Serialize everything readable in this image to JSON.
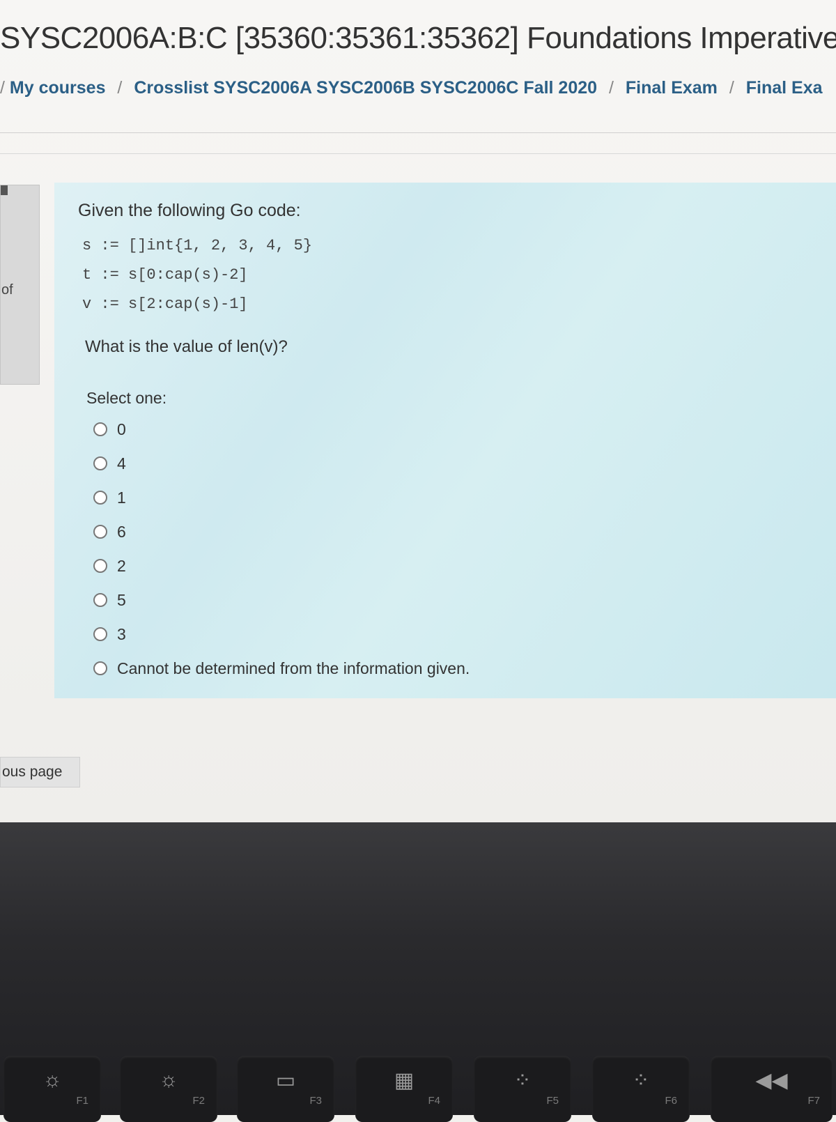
{
  "page": {
    "title": "SYSC2006A:B:C [35360:35361:35362] Foundations Imperative",
    "breadcrumb": [
      "My courses",
      "Crosslist SYSC2006A SYSC2006B SYSC2006C Fall 2020",
      "Final Exam",
      "Final Exa"
    ]
  },
  "sidebar": {
    "info_fragment": "of",
    "previous_page_label": "ous page"
  },
  "question": {
    "intro": "Given the following Go code:",
    "code": [
      "s := []int{1, 2, 3, 4, 5}",
      "t := s[0:cap(s)-2]",
      "v := s[2:cap(s)-1]"
    ],
    "prompt": "What is the value of len(v)?",
    "select_label": "Select one:",
    "options": [
      "0",
      "4",
      "1",
      "6",
      "2",
      "5",
      "3",
      "Cannot be determined from the information given."
    ]
  },
  "keyboard": {
    "keys": [
      {
        "icon": "brightness-down-icon",
        "glyph": "☼",
        "label": "F1"
      },
      {
        "icon": "brightness-up-icon",
        "glyph": "☼",
        "label": "F2"
      },
      {
        "icon": "mission-control-icon",
        "glyph": "▭",
        "label": "F3"
      },
      {
        "icon": "launchpad-icon",
        "glyph": "▦",
        "label": "F4"
      },
      {
        "icon": "keyboard-light-down-icon",
        "glyph": "⁘",
        "label": "F5"
      },
      {
        "icon": "keyboard-light-up-icon",
        "glyph": "⁘",
        "label": "F6"
      },
      {
        "icon": "rewind-icon",
        "glyph": "◀◀",
        "label": "F7"
      }
    ]
  },
  "colors": {
    "breadcrumb_link": "#2b5f86",
    "question_bg": "#d4edf1"
  }
}
